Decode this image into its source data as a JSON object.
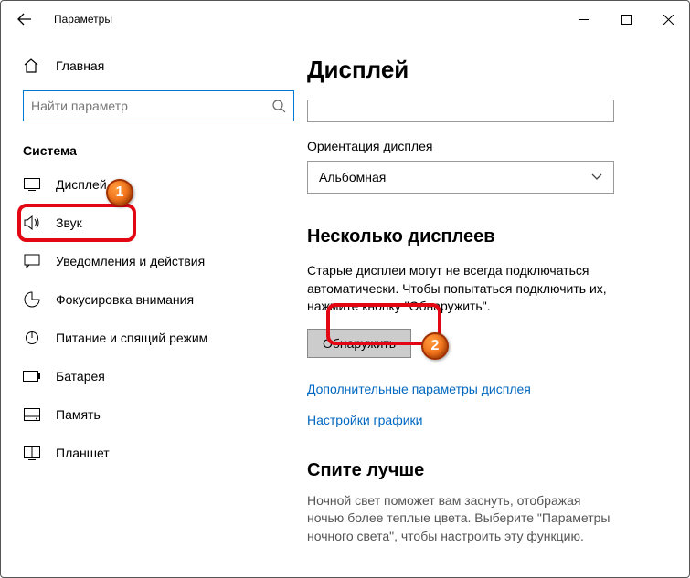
{
  "titlebar": {
    "title": "Параметры"
  },
  "sidebar": {
    "home": "Главная",
    "search_placeholder": "Найти параметр",
    "section": "Система",
    "items": [
      {
        "label": "Дисплей"
      },
      {
        "label": "Звук"
      },
      {
        "label": "Уведомления и действия"
      },
      {
        "label": "Фокусировка внимания"
      },
      {
        "label": "Питание и спящий режим"
      },
      {
        "label": "Батарея"
      },
      {
        "label": "Память"
      },
      {
        "label": "Планшет"
      }
    ]
  },
  "main": {
    "title": "Дисплей",
    "orientation_label": "Ориентация дисплея",
    "orientation_value": "Альбомная",
    "multi_head": "Несколько дисплеев",
    "multi_text": "Старые дисплеи могут не всегда подключаться автоматически. Чтобы попытаться подключить их, нажмите кнопку \"Обнаружить\".",
    "detect_btn": "Обнаружить",
    "link_advanced": "Дополнительные параметры дисплея",
    "link_graphics": "Настройки графики",
    "sleep_head": "Спите лучше",
    "sleep_text": "Ночной свет поможет вам заснуть, отображая ночью более теплые цвета. Выберите \"Параметры ночного света\", чтобы настроить эту функцию."
  },
  "callouts": {
    "one": "1",
    "two": "2"
  }
}
